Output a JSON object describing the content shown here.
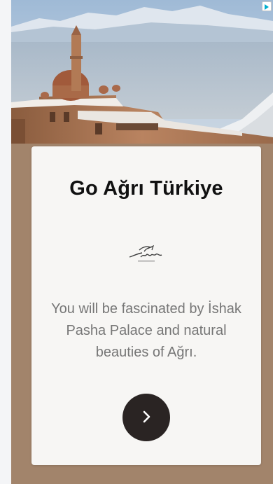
{
  "ad": {
    "title": "Go Ağrı Türkiye",
    "description": "You will be fascinated by İshak Pasha Palace and natural beauties of Ağrı.",
    "logo_icon": "turkiye-logo",
    "cta_icon": "chevron-right-icon",
    "adchoices_icon": "adchoices-icon"
  },
  "colors": {
    "background": "#a2846b",
    "card": "#f7f6f4",
    "title": "#111111",
    "text": "#767676",
    "button": "#2a2423"
  }
}
